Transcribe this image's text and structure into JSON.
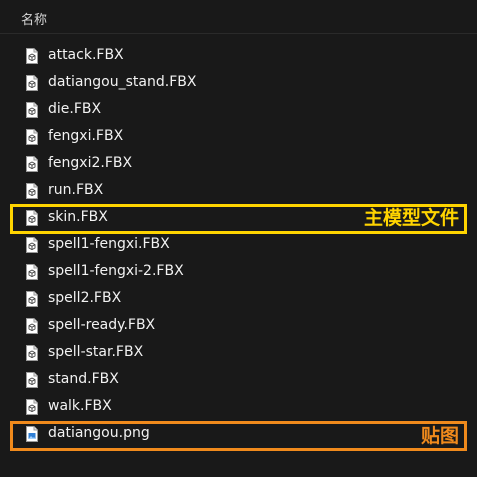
{
  "header": {
    "column_name": "名称"
  },
  "files": [
    {
      "name": "attack.FBX",
      "icon": "fbx-file-icon"
    },
    {
      "name": "datiangou_stand.FBX",
      "icon": "fbx-file-icon"
    },
    {
      "name": "die.FBX",
      "icon": "fbx-file-icon"
    },
    {
      "name": "fengxi.FBX",
      "icon": "fbx-file-icon"
    },
    {
      "name": "fengxi2.FBX",
      "icon": "fbx-file-icon"
    },
    {
      "name": "run.FBX",
      "icon": "fbx-file-icon"
    },
    {
      "name": "skin.FBX",
      "icon": "fbx-file-icon"
    },
    {
      "name": "spell1-fengxi.FBX",
      "icon": "fbx-file-icon"
    },
    {
      "name": "spell1-fengxi-2.FBX",
      "icon": "fbx-file-icon"
    },
    {
      "name": "spell2.FBX",
      "icon": "fbx-file-icon"
    },
    {
      "name": "spell-ready.FBX",
      "icon": "fbx-file-icon"
    },
    {
      "name": "spell-star.FBX",
      "icon": "fbx-file-icon"
    },
    {
      "name": "stand.FBX",
      "icon": "fbx-file-icon"
    },
    {
      "name": "walk.FBX",
      "icon": "fbx-file-icon"
    },
    {
      "name": "datiangou.png",
      "icon": "png-file-icon"
    }
  ],
  "annotations": {
    "main_model": "主模型文件",
    "texture": "贴图"
  },
  "colors": {
    "background": "#191919",
    "main_model_highlight": "#ffd400",
    "texture_highlight": "#f08a1c"
  }
}
